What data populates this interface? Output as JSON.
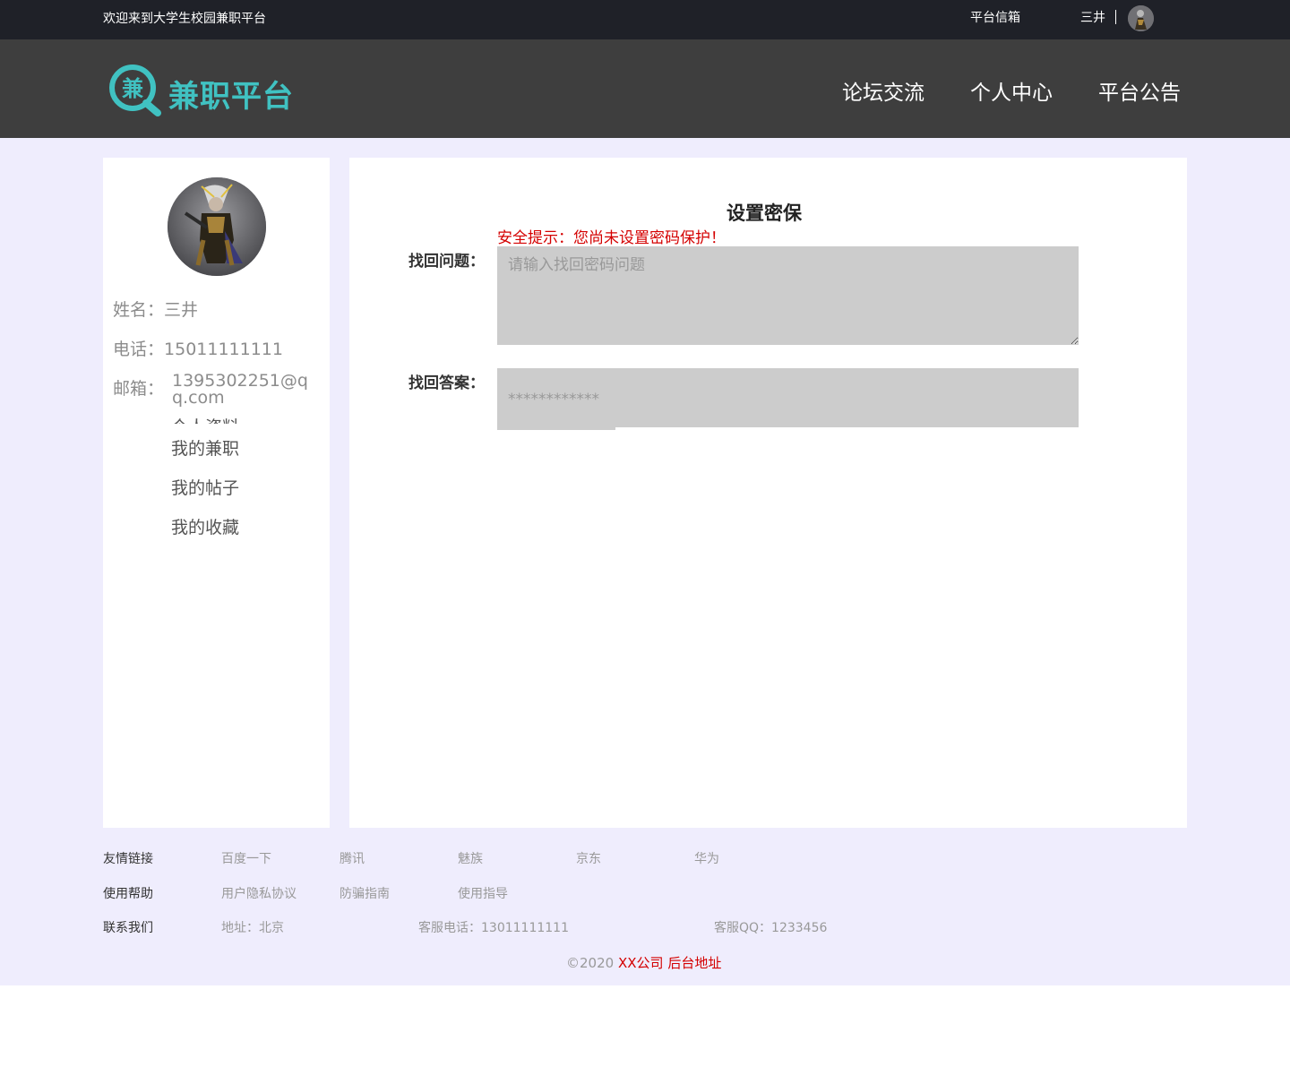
{
  "topbar": {
    "welcome": "欢迎来到大学生校园兼职平台",
    "mailbox": "平台信箱",
    "username": "三井"
  },
  "header": {
    "logo_badge": "兼",
    "logo_text": "兼职平台",
    "nav": [
      "论坛交流",
      "个人中心",
      "平台公告"
    ]
  },
  "sidebar": {
    "name_label": "姓名：",
    "name_value": "三井",
    "phone_label": "电话：",
    "phone_value": "15011111111",
    "email_label": "邮箱：",
    "email_value": "1395302251@qq.com",
    "menu": [
      "个人资料",
      "我的兼职",
      "我的帖子",
      "我的收藏"
    ]
  },
  "main": {
    "title": "设置密保",
    "warning": "安全提示：您尚未设置密码保护！",
    "question_label": "找回问题：",
    "question_placeholder": "请输入找回密码问题",
    "answer_label": "找回答案：",
    "answer_placeholder": "************"
  },
  "footer": {
    "links_label": "友情链接",
    "links": [
      "百度一下",
      "腾讯",
      "魅族",
      "京东",
      "华为"
    ],
    "help_label": "使用帮助",
    "help": [
      "用户隐私协议",
      "防骗指南",
      "使用指导"
    ],
    "contact_label": "联系我们",
    "address": "地址：北京",
    "service_phone": "客服电话：13011111111",
    "service_qq": "客服QQ：1233456",
    "copyright_prefix": "©2020",
    "company": "XX公司",
    "admin_link": "后台地址"
  },
  "colors": {
    "topbar_bg": "#1f2128",
    "header_bg": "#3e3e3e",
    "logo_teal": "#40c2c2",
    "page_bg": "#efedfd",
    "warning_red": "#d40000",
    "input_bg": "#cccccc"
  }
}
